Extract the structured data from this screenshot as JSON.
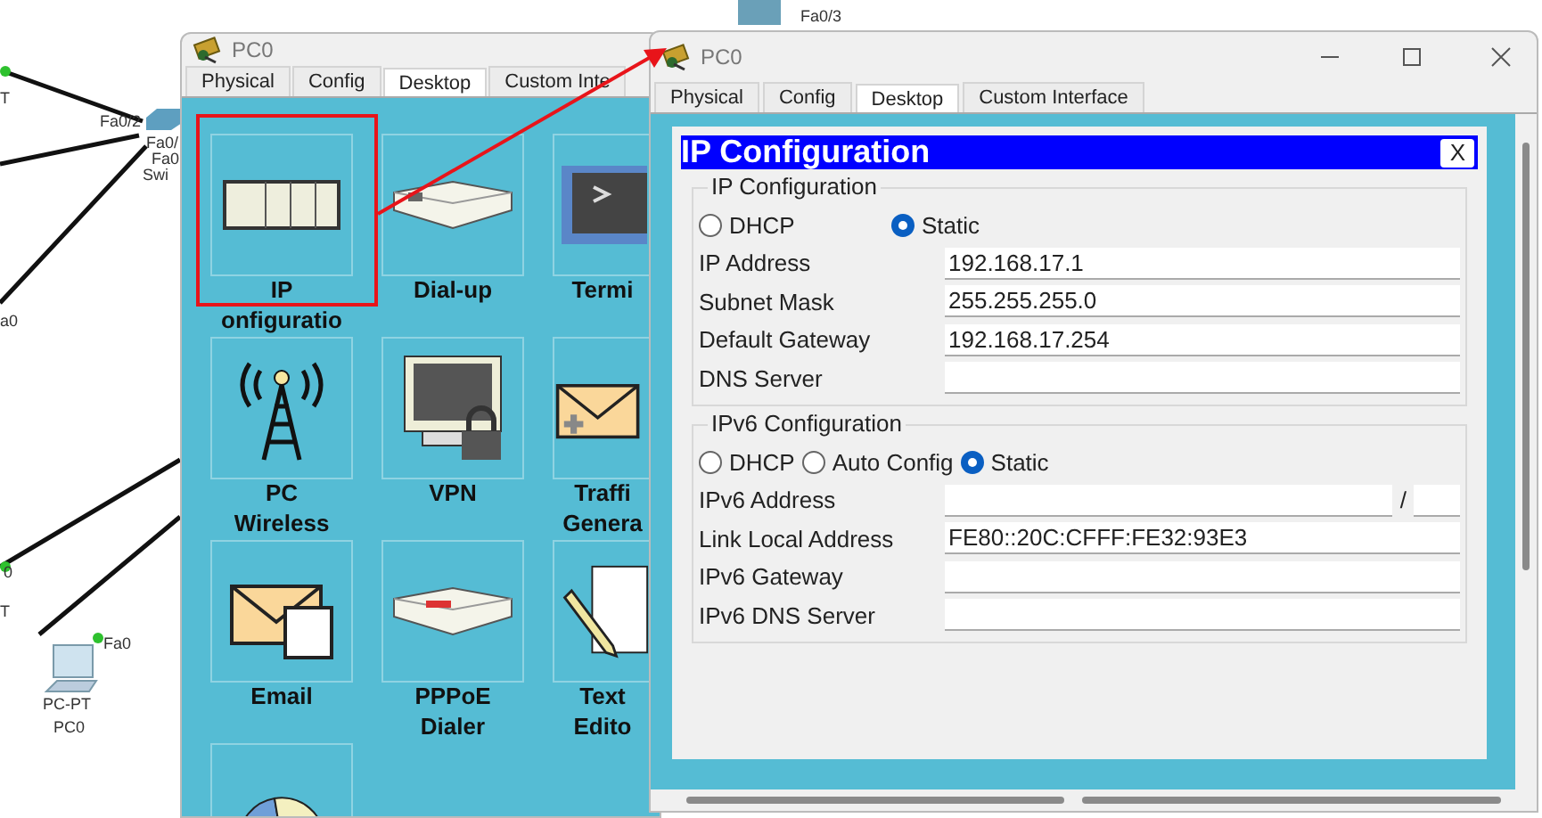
{
  "topology": {
    "labels": [
      "T",
      "Fa0/2",
      "Fa0/",
      "Fa0",
      "Swi",
      "a0",
      "0",
      "T",
      "Fa0",
      "PC-PT",
      "PC0",
      "Fa0/3"
    ]
  },
  "desktop_window": {
    "title": "PC0",
    "tabs": [
      {
        "label": "Physical",
        "selected": false
      },
      {
        "label": "Config",
        "selected": false
      },
      {
        "label": "Desktop",
        "selected": true
      },
      {
        "label": "Custom Inte",
        "selected": false
      }
    ],
    "apps": [
      {
        "kind": "ip",
        "label": [
          "IP",
          "onfiguratio"
        ]
      },
      {
        "kind": "dialup",
        "label": [
          "Dial-up"
        ]
      },
      {
        "kind": "terminal",
        "label": [
          "Termi"
        ]
      },
      {
        "kind": "wireless",
        "label": [
          "PC",
          "Wireless"
        ]
      },
      {
        "kind": "vpn",
        "label": [
          "VPN"
        ]
      },
      {
        "kind": "traffic",
        "label": [
          "Traffi",
          "Genera"
        ]
      },
      {
        "kind": "email",
        "label": [
          "Email"
        ]
      },
      {
        "kind": "pppoe",
        "label": [
          "PPPoE",
          "Dialer"
        ]
      },
      {
        "kind": "text",
        "label": [
          "Text",
          "Edito"
        ]
      },
      {
        "kind": "pie"
      }
    ]
  },
  "ip_window": {
    "title": "PC0",
    "tabs": [
      {
        "label": "Physical",
        "selected": false
      },
      {
        "label": "Config",
        "selected": false
      },
      {
        "label": "Desktop",
        "selected": true
      },
      {
        "label": "Custom Interface",
        "selected": false
      }
    ],
    "dialog": {
      "title": "IP Configuration",
      "close": "X",
      "ipv4": {
        "legend": "IP Configuration",
        "modes": [
          {
            "label": "DHCP",
            "selected": false
          },
          {
            "label": "Static",
            "selected": true
          }
        ],
        "fields": [
          {
            "label": "IP Address",
            "value": "192.168.17.1"
          },
          {
            "label": "Subnet Mask",
            "value": "255.255.255.0"
          },
          {
            "label": "Default Gateway",
            "value": "192.168.17.254"
          },
          {
            "label": "DNS Server"
          }
        ]
      },
      "ipv6": {
        "legend": "IPv6 Configuration",
        "modes": [
          {
            "label": "DHCP",
            "selected": false
          },
          {
            "label": "Auto Config",
            "selected": false
          },
          {
            "label": "Static",
            "selected": true
          }
        ],
        "fields": [
          {
            "label": "IPv6 Address",
            "kind": "prefix",
            "separator": "/"
          },
          {
            "label": "Link Local Address",
            "value": "FE80::20C:CFFF:FE32:93E3"
          },
          {
            "label": "IPv6 Gateway"
          },
          {
            "label": "IPv6 DNS Server"
          }
        ]
      }
    }
  }
}
